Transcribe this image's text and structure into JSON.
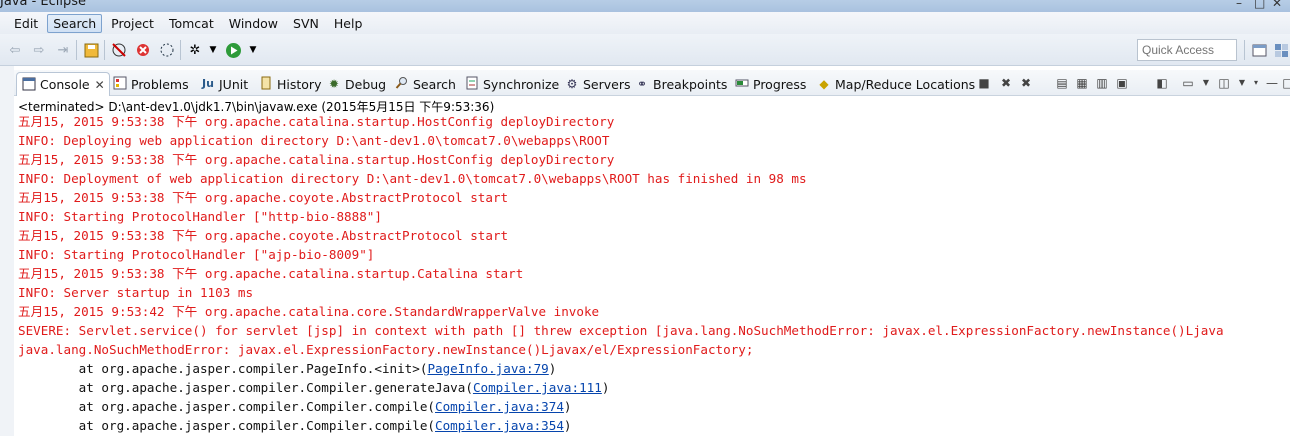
{
  "window": {
    "title": "Java - Eclipse",
    "controls": [
      "–",
      "□",
      "✕"
    ]
  },
  "menubar": {
    "items": [
      "Edit",
      "Search",
      "Project",
      "Tomcat",
      "Window",
      "SVN",
      "Help"
    ],
    "active": "Search"
  },
  "toolbar": {
    "quick_access_placeholder": "Quick Access",
    "icons": [
      "back-icon",
      "forward-icon",
      "next-edit-icon",
      "save-icon",
      "debug-skip-icon",
      "remove-icon",
      "run-last-icon",
      "settings-icon",
      "dropdown-arrow",
      "run-icon",
      "dropdown-arrow"
    ]
  },
  "tabs": [
    {
      "label": "Console",
      "icon": "console-icon",
      "active": true,
      "closable": true
    },
    {
      "label": "Problems",
      "icon": "problems-icon"
    },
    {
      "label": "JUnit",
      "icon": "junit-icon",
      "prefix": "Ju"
    },
    {
      "label": "History",
      "icon": "history-icon"
    },
    {
      "label": "Debug",
      "icon": "debug-icon"
    },
    {
      "label": "Search",
      "icon": "search-icon"
    },
    {
      "label": "Synchronize",
      "icon": "sync-icon"
    },
    {
      "label": "Servers",
      "icon": "servers-icon"
    },
    {
      "label": "Breakpoints",
      "icon": "breakpoints-icon"
    },
    {
      "label": "Progress",
      "icon": "progress-icon"
    },
    {
      "label": "Map/Reduce Locations",
      "icon": "elephant-icon"
    }
  ],
  "console": {
    "status": "<terminated> D:\\ant-dev1.0\\jdk1.7\\bin\\javaw.exe (2015年5月15日 下午9:53:36)",
    "lines": [
      {
        "type": "err",
        "text": "五月15, 2015 9:53:38 下午 org.apache.catalina.startup.HostConfig deployDirectory"
      },
      {
        "type": "err",
        "text": "INFO: Deploying web application directory D:\\ant-dev1.0\\tomcat7.0\\webapps\\ROOT"
      },
      {
        "type": "err",
        "text": "五月15, 2015 9:53:38 下午 org.apache.catalina.startup.HostConfig deployDirectory"
      },
      {
        "type": "err",
        "text": "INFO: Deployment of web application directory D:\\ant-dev1.0\\tomcat7.0\\webapps\\ROOT has finished in 98 ms"
      },
      {
        "type": "err",
        "text": "五月15, 2015 9:53:38 下午 org.apache.coyote.AbstractProtocol start"
      },
      {
        "type": "err",
        "text": "INFO: Starting ProtocolHandler [\"http-bio-8888\"]"
      },
      {
        "type": "err",
        "text": "五月15, 2015 9:53:38 下午 org.apache.coyote.AbstractProtocol start"
      },
      {
        "type": "err",
        "text": "INFO: Starting ProtocolHandler [\"ajp-bio-8009\"]"
      },
      {
        "type": "err",
        "text": "五月15, 2015 9:53:38 下午 org.apache.catalina.startup.Catalina start"
      },
      {
        "type": "err",
        "text": "INFO: Server startup in 1103 ms"
      },
      {
        "type": "err",
        "text": "五月15, 2015 9:53:42 下午 org.apache.catalina.core.StandardWrapperValve invoke"
      },
      {
        "type": "err",
        "text": "SEVERE: Servlet.service() for servlet [jsp] in context with path [] threw exception [java.lang.NoSuchMethodError: javax.el.ExpressionFactory.newInstance()Ljava"
      },
      {
        "type": "err",
        "text": "java.lang.NoSuchMethodError: javax.el.ExpressionFactory.newInstance()Ljavax/el/ExpressionFactory;"
      },
      {
        "type": "trace",
        "text": "\tat org.apache.jasper.compiler.PageInfo.<init>(",
        "link": "PageInfo.java:79",
        "after": ")"
      },
      {
        "type": "trace",
        "text": "\tat org.apache.jasper.compiler.Compiler.generateJava(",
        "link": "Compiler.java:111",
        "after": ")"
      },
      {
        "type": "trace",
        "text": "\tat org.apache.jasper.compiler.Compiler.compile(",
        "link": "Compiler.java:374",
        "after": ")"
      },
      {
        "type": "trace",
        "text": "\tat org.apache.jasper.compiler.Compiler.compile(",
        "link": "Compiler.java:354",
        "after": ")"
      }
    ]
  },
  "colors": {
    "error_text": "#e01b1b",
    "link": "#0645ad",
    "chrome_blue": "#dbe6f3"
  }
}
